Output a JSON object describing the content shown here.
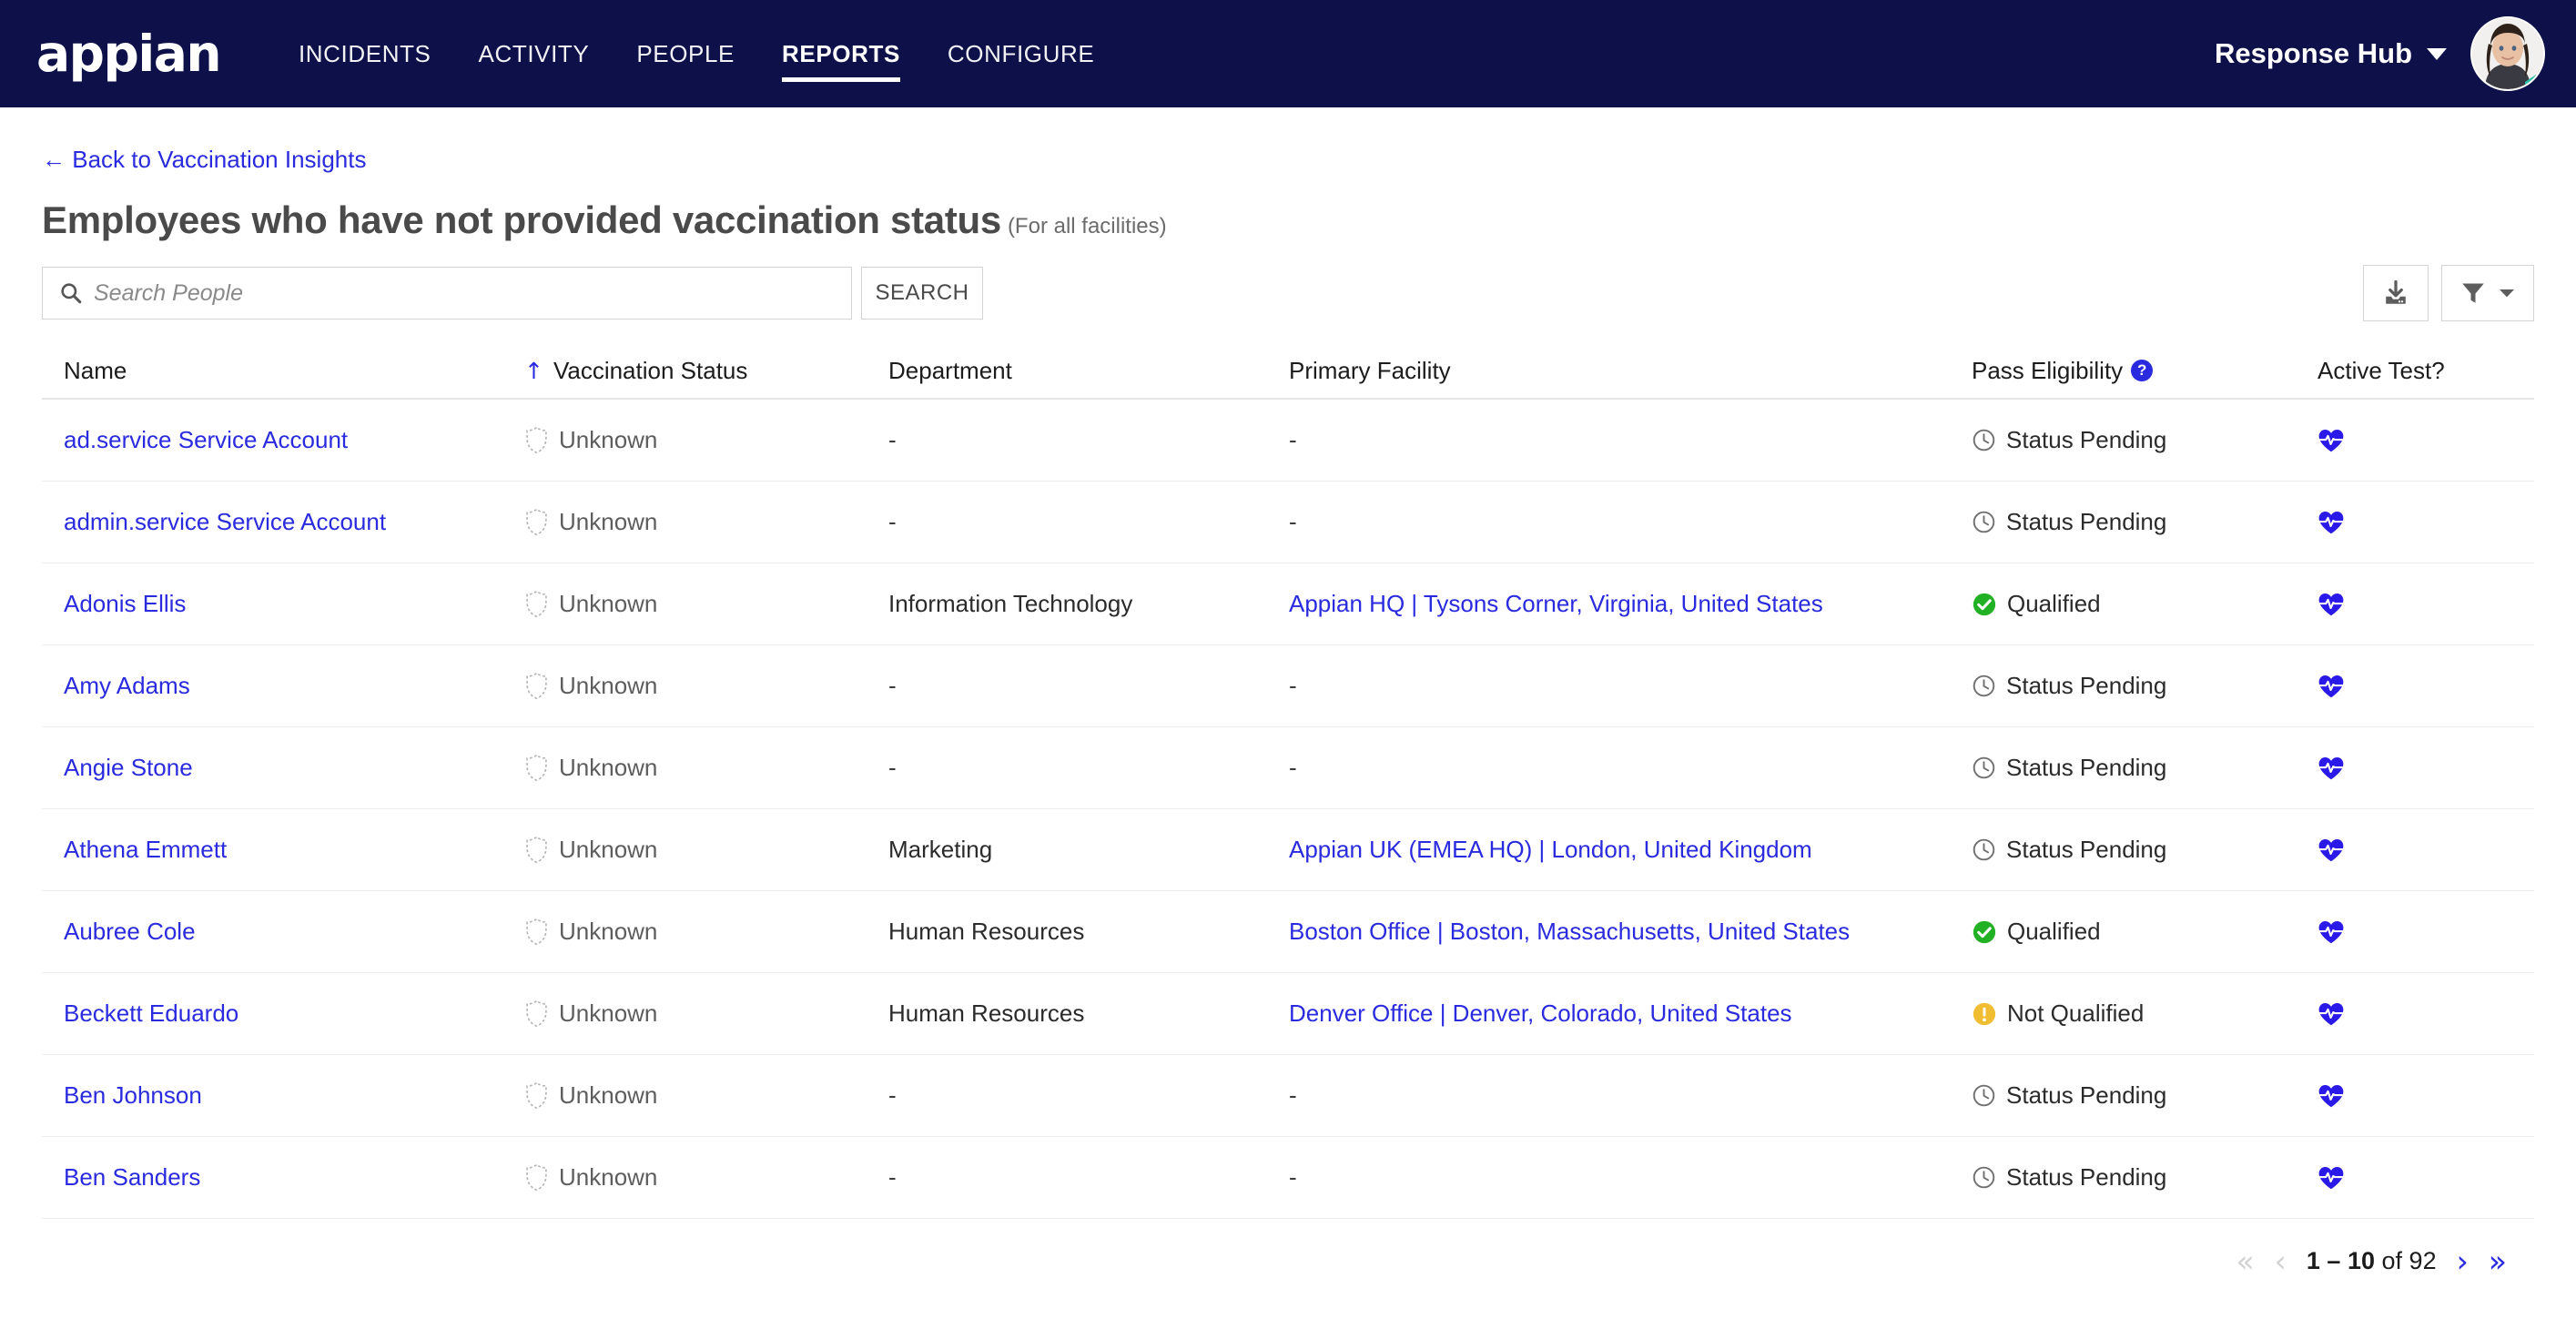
{
  "topnav": {
    "brand": "appian",
    "items": [
      {
        "label": "INCIDENTS",
        "active": false
      },
      {
        "label": "ACTIVITY",
        "active": false
      },
      {
        "label": "PEOPLE",
        "active": false
      },
      {
        "label": "REPORTS",
        "active": true
      },
      {
        "label": "CONFIGURE",
        "active": false
      }
    ],
    "hub_label": "Response Hub",
    "avatar_alt": "user-avatar",
    "background_color": "#0d1049"
  },
  "breadcrumb": {
    "back_label": "← Back to Vaccination Insights"
  },
  "header": {
    "title": "Employees who have not provided vaccination status",
    "title_suffix": "(For all facilities)"
  },
  "toolbar": {
    "search_placeholder": "Search People",
    "search_value": "",
    "search_button": "SEARCH",
    "download_icon": "download-icon",
    "filter_icon": "filter-icon"
  },
  "table": {
    "columns": [
      {
        "label": "Name",
        "sorted": false
      },
      {
        "label": "Vaccination Status",
        "sorted": true,
        "sort_dir": "asc"
      },
      {
        "label": "Department",
        "sorted": false
      },
      {
        "label": "Primary Facility",
        "sorted": false
      },
      {
        "label": "Pass Eligibility",
        "sorted": false,
        "help": true
      },
      {
        "label": "Active Test?",
        "sorted": false
      }
    ],
    "rows": [
      {
        "name": "ad.service Service Account",
        "vaccination_status": "Unknown",
        "department": "-",
        "department_link": false,
        "facility": "-",
        "facility_link": false,
        "pass_eligibility": "Status Pending",
        "pass_state": "pending",
        "active_test": "heart-pulse-icon"
      },
      {
        "name": "admin.service Service Account",
        "vaccination_status": "Unknown",
        "department": "-",
        "department_link": false,
        "facility": "-",
        "facility_link": false,
        "pass_eligibility": "Status Pending",
        "pass_state": "pending",
        "active_test": "heart-pulse-icon"
      },
      {
        "name": "Adonis Ellis",
        "vaccination_status": "Unknown",
        "department": "Information Technology",
        "department_link": false,
        "facility": "Appian HQ | Tysons Corner, Virginia, United States",
        "facility_link": true,
        "pass_eligibility": "Qualified",
        "pass_state": "qualified",
        "active_test": "heart-pulse-icon"
      },
      {
        "name": "Amy Adams",
        "vaccination_status": "Unknown",
        "department": "-",
        "department_link": false,
        "facility": "-",
        "facility_link": false,
        "pass_eligibility": "Status Pending",
        "pass_state": "pending",
        "active_test": "heart-pulse-icon"
      },
      {
        "name": "Angie Stone",
        "vaccination_status": "Unknown",
        "department": "-",
        "department_link": false,
        "facility": "-",
        "facility_link": false,
        "pass_eligibility": "Status Pending",
        "pass_state": "pending",
        "active_test": "heart-pulse-icon"
      },
      {
        "name": "Athena Emmett",
        "vaccination_status": "Unknown",
        "department": "Marketing",
        "department_link": false,
        "facility": "Appian UK (EMEA HQ) | London, United Kingdom",
        "facility_link": true,
        "pass_eligibility": "Status Pending",
        "pass_state": "pending",
        "active_test": "heart-pulse-icon"
      },
      {
        "name": "Aubree Cole",
        "vaccination_status": "Unknown",
        "department": "Human Resources",
        "department_link": false,
        "facility": "Boston Office | Boston, Massachusetts, United States",
        "facility_link": true,
        "pass_eligibility": "Qualified",
        "pass_state": "qualified",
        "active_test": "heart-pulse-icon"
      },
      {
        "name": "Beckett Eduardo",
        "vaccination_status": "Unknown",
        "department": "Human Resources",
        "department_link": false,
        "facility": "Denver Office | Denver, Colorado, United States",
        "facility_link": true,
        "pass_eligibility": "Not Qualified",
        "pass_state": "not_qualified",
        "active_test": "heart-pulse-icon"
      },
      {
        "name": "Ben Johnson",
        "vaccination_status": "Unknown",
        "department": "-",
        "department_link": false,
        "facility": "-",
        "facility_link": false,
        "pass_eligibility": "Status Pending",
        "pass_state": "pending",
        "active_test": "heart-pulse-icon"
      },
      {
        "name": "Ben Sanders",
        "vaccination_status": "Unknown",
        "department": "-",
        "department_link": false,
        "facility": "-",
        "facility_link": false,
        "pass_eligibility": "Status Pending",
        "pass_state": "pending",
        "active_test": "heart-pulse-icon"
      }
    ]
  },
  "pagination": {
    "first_label": "«",
    "prev_label": "‹",
    "next_label": "›",
    "last_label": "»",
    "range_start": "1",
    "range_dash": "–",
    "range_end": "10",
    "of_label": "of",
    "total": "92",
    "summary": "1 – 10 of 92",
    "first_enabled": false,
    "prev_enabled": false,
    "next_enabled": true,
    "last_enabled": true
  },
  "colors": {
    "nav_background": "#0d1049",
    "link": "#2a2adf",
    "qualified_green": "#22b024",
    "not_qualified_amber": "#f0bd32",
    "pending_gray": "#6b6b6b",
    "active_test_blue": "#2a19e8"
  }
}
